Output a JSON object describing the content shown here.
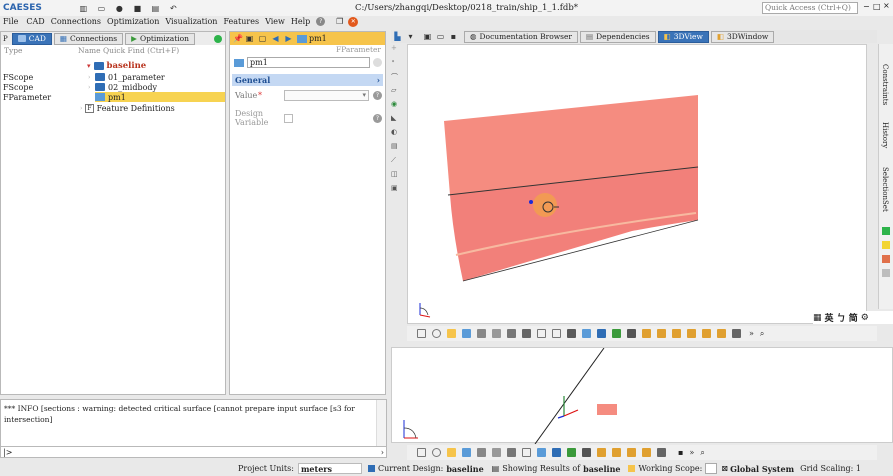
{
  "app": {
    "logo": "CAESES",
    "file_path": "C:/Users/zhangqi/Desktop/0218_train/ship_1_1.fdb*",
    "quick_access": "Quick Access (Ctrl+Q)"
  },
  "menu": [
    "File",
    "CAD",
    "Connections",
    "Optimization",
    "Visualization",
    "Features",
    "View",
    "Help"
  ],
  "left_tabs": [
    "CAD",
    "Connections",
    "Optimization"
  ],
  "tree": {
    "col_type": "Type",
    "col_name": "Name",
    "quick_find": "Quick Find (Ctrl+F)",
    "root": "baseline",
    "rows": [
      {
        "type": "FScope",
        "name": "01_parameter"
      },
      {
        "type": "FScope",
        "name": "02_midbody"
      },
      {
        "type": "FParameter",
        "name": "pm1"
      }
    ],
    "feature_defs": "Feature Definitions"
  },
  "props": {
    "header_name": "pm1",
    "class": "FParameter",
    "name_field": "pm1",
    "section": "General",
    "value_label": "Value",
    "design_var_label": "Design Variable"
  },
  "view_tabs": [
    "Documentation Browser",
    "Dependencies",
    "3DView",
    "3DWindow"
  ],
  "right_side": [
    "Constraints",
    "History",
    "SelectionSet"
  ],
  "legend_colors": [
    "#2db34a",
    "#f2d533",
    "#e0704a",
    "#bdbdbd"
  ],
  "ime": "英 ㄅ 简",
  "console": {
    "text": "*** INFO [sections : warning: detected critical surface [cannot prepare input surface [s3 for intersection]",
    "prompt": "|>"
  },
  "status": {
    "units_label": "Project Units:",
    "units": "meters",
    "design_label": "Current Design:",
    "design": "baseline",
    "results_label": "Showing Results of",
    "results": "baseline",
    "scope_label": "Working Scope:",
    "system": "Global System",
    "scaling": "Grid Scaling: 1"
  }
}
